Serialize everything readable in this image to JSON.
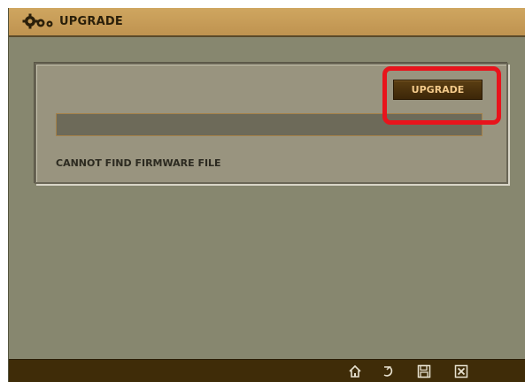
{
  "window": {
    "title": "UPGRADE",
    "title_icon": "gears-icon"
  },
  "panel": {
    "upgrade_button_label": "UPGRADE",
    "status_message": "CANNOT FIND FIRMWARE FILE",
    "progress": 0
  },
  "toolbar": {
    "buttons": [
      {
        "name": "home",
        "icon": "home-icon"
      },
      {
        "name": "back",
        "icon": "back-icon"
      },
      {
        "name": "save",
        "icon": "save-icon"
      },
      {
        "name": "close",
        "icon": "close-icon"
      }
    ]
  },
  "colors": {
    "accent": "#c49a56",
    "highlight": "#e8141c",
    "bottom_bar": "#3f2c08"
  }
}
